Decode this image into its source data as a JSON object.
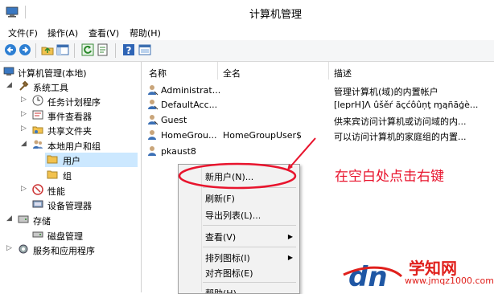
{
  "window": {
    "title": "计算机管理"
  },
  "menu": [
    "文件(F)",
    "操作(A)",
    "查看(V)",
    "帮助(H)"
  ],
  "tree": {
    "root": "计算机管理(本地)",
    "system_tools": "系统工具",
    "task_scheduler": "任务计划程序",
    "event_viewer": "事件查看器",
    "shared_folders": "共享文件夹",
    "local_users_groups": "本地用户和组",
    "users": "用户",
    "groups": "组",
    "performance": "性能",
    "device_manager": "设备管理器",
    "storage": "存储",
    "disk_management": "磁盘管理",
    "services_apps": "服务和应用程序"
  },
  "list": {
    "columns": [
      "名称",
      "全名",
      "描述"
    ],
    "rows": [
      {
        "name": "Administrat...",
        "full": "",
        "desc": "管理计算机(域)的内置帐户"
      },
      {
        "name": "DefaultAcc...",
        "full": "",
        "desc": "[leprH]Λ ûšěŕ ãçćôûņţ ɱąñāģè..."
      },
      {
        "name": "Guest",
        "full": "",
        "desc": "供来宾访问计算机或访问域的内..."
      },
      {
        "name": "HomeGrou...",
        "full": "HomeGroupUser$",
        "desc": "可以访问计算机的家庭组的内置..."
      },
      {
        "name": "pkaust8",
        "full": "",
        "desc": ""
      }
    ]
  },
  "context_menu": {
    "new_user": "新用户(N)...",
    "refresh": "刷新(F)",
    "export": "导出列表(L)...",
    "view": "查看(V)",
    "arrange": "排列图标(I)",
    "lineup": "对齐图标(E)",
    "help": "帮助(H)"
  },
  "annotation": "在空白处点击右键",
  "watermark": {
    "site": "学知网",
    "url": "www.jmqz1000.com"
  },
  "colors": {
    "annotation_red": "#e8142d",
    "selection": "#cce8ff"
  }
}
